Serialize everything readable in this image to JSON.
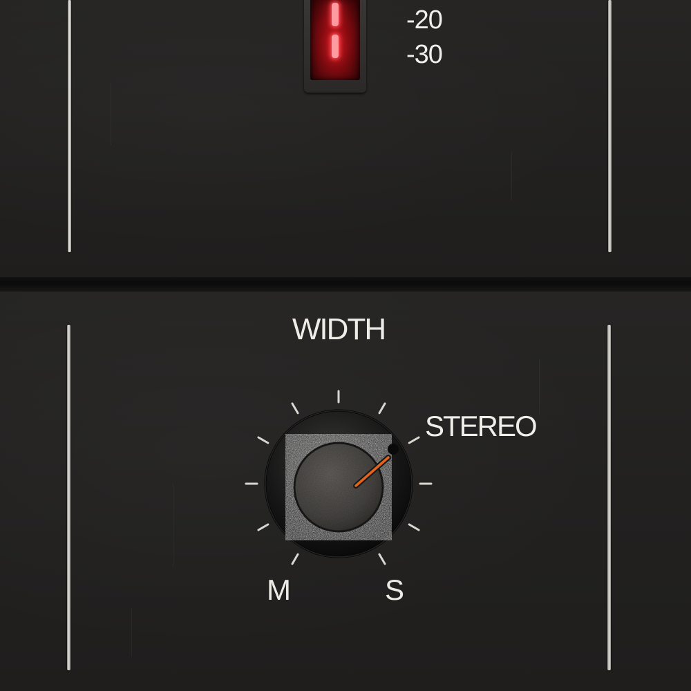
{
  "meter": {
    "scale_labels": [
      "-20",
      "-30"
    ]
  },
  "width_control": {
    "title": "WIDTH",
    "stereo_label": "STEREO",
    "min_label": "M",
    "max_label": "S",
    "tick_count": 11,
    "pointer_position": "STEREO",
    "indicator_color": "#e3641c"
  },
  "colors": {
    "panel": "#222120",
    "meter_glow": "#ff4f5a",
    "label_text": "#efede7"
  },
  "icons": {
    "meter": "led-meter-icon",
    "knob": "rotary-knob-icon"
  }
}
